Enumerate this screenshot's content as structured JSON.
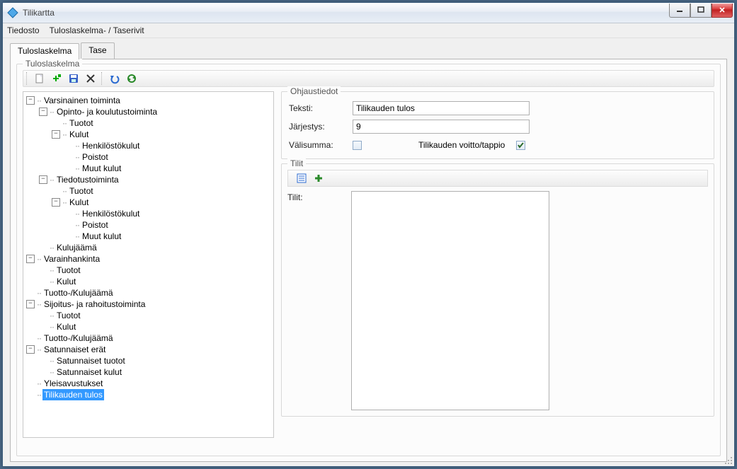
{
  "window": {
    "title": "Tilikartta"
  },
  "menu": {
    "file": "Tiedosto",
    "second": "Tuloslaskelma- / Taserivit"
  },
  "tabs": {
    "t1": "Tuloslaskelma",
    "t2": "Tase"
  },
  "group": {
    "tulos": "Tuloslaskelma",
    "ohjaus": "Ohjaustiedot",
    "tilit": "Tilit"
  },
  "tree": {
    "varsinainen": "Varsinainen toiminta",
    "opinto": "Opinto- ja koulutustoiminta",
    "tuotot": "Tuotot",
    "kulut": "Kulut",
    "henkilosto": "Henkilöstökulut",
    "poistot": "Poistot",
    "muutkulut": "Muut kulut",
    "tiedotus": "Tiedotustoiminta",
    "kulujaama": "Kulujäämä",
    "varainhankinta": "Varainhankinta",
    "tuottokulujaama": "Tuotto-/Kulujäämä",
    "sijoitus": "Sijoitus- ja rahoitustoiminta",
    "satunnaiset": "Satunnaiset erät",
    "sat_tuotot": "Satunnaiset tuotot",
    "sat_kulut": "Satunnaiset kulut",
    "yleisavustukset": "Yleisavustukset",
    "tilikauden": "Tilikauden tulos"
  },
  "ohjaus": {
    "teksti_label": "Teksti:",
    "teksti_value": "Tilikauden tulos",
    "jarjestys_label": "Järjestys:",
    "jarjestys_value": "9",
    "valisumma_label": "Välisumma:",
    "voittotappio_label": "Tilikauden voitto/tappio",
    "valisumma_checked": false,
    "voittotappio_checked": true
  },
  "tilit": {
    "label": "Tilit:"
  }
}
